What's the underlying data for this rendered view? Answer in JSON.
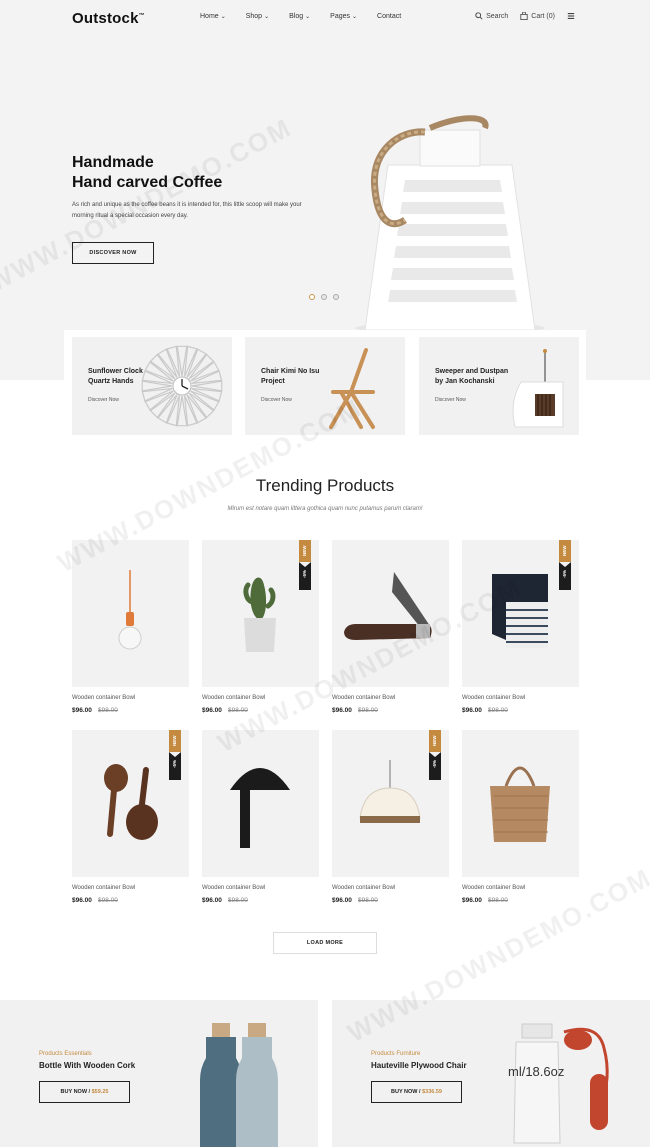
{
  "brand": {
    "name": "Outstock",
    "mark": "™"
  },
  "nav": [
    {
      "label": "Home",
      "dropdown": true
    },
    {
      "label": "Shop",
      "dropdown": true
    },
    {
      "label": "Blog",
      "dropdown": true
    },
    {
      "label": "Pages",
      "dropdown": true
    },
    {
      "label": "Contact",
      "dropdown": false
    }
  ],
  "tools": {
    "search": "Search",
    "cart": "Cart (0)"
  },
  "hero": {
    "title_line1": "Handmade",
    "title_line2": "Hand carved Coffee",
    "description": "As rich and unique as the coffee beans it is intended for, this little scoop will make your morning ritual a special occasion every day.",
    "button": "DISCOVER NOW",
    "slides": 3,
    "active_slide": 1
  },
  "categories": [
    {
      "title": "Sunflower Clock Quartz Hands",
      "link": "Discover Now"
    },
    {
      "title": "Chair Kimi No Isu Project",
      "link": "Discover Now"
    },
    {
      "title": "Sweeper and Dustpan by Jan Kochanski",
      "link": "Discover Now"
    }
  ],
  "trending": {
    "title": "Trending Products",
    "subtitle": "Mirum est notare quam littera gothica quam nunc putamus parum claram!",
    "products": [
      {
        "name": "Wooden container Bowl",
        "price": "$96.00",
        "old_price": "$98.00",
        "image": "pendant-bulb",
        "badge": false
      },
      {
        "name": "Wooden container Bowl",
        "price": "$96.00",
        "old_price": "$98.00",
        "image": "cactus-pot",
        "badge": true
      },
      {
        "name": "Wooden container Bowl",
        "price": "$96.00",
        "old_price": "$98.00",
        "image": "pocket-knife",
        "badge": false
      },
      {
        "name": "Wooden container Bowl",
        "price": "$96.00",
        "old_price": "$98.00",
        "image": "striped-towel",
        "badge": true
      },
      {
        "name": "Wooden container Bowl",
        "price": "$96.00",
        "old_price": "$98.00",
        "image": "wooden-spoons",
        "badge": true
      },
      {
        "name": "Wooden container Bowl",
        "price": "$96.00",
        "old_price": "$98.00",
        "image": "black-lamp",
        "badge": false
      },
      {
        "name": "Wooden container Bowl",
        "price": "$96.00",
        "old_price": "$98.00",
        "image": "pendant-lamp",
        "badge": true
      },
      {
        "name": "Wooden container Bowl",
        "price": "$96.00",
        "old_price": "$98.00",
        "image": "woven-bag",
        "badge": false
      }
    ],
    "badge_new": "NEW",
    "badge_sale": "-5%"
  },
  "load_more": "LOAD MORE",
  "promos": [
    {
      "sub": "Products Essentials",
      "title": "Bottle With Wooden Cork",
      "button": "BUY NOW",
      "price": "$59.25"
    },
    {
      "sub": "Products Furniture",
      "title": "Hauteville Plywood Chair",
      "button": "BUY NOW",
      "price": "$336.59"
    }
  ],
  "bottle_label": "ml/18.6oz",
  "watermark": "WWW.DOWNDEMO.COM",
  "colors": {
    "accent": "#c48a3f",
    "dark": "#1c1c1c",
    "hero_bg": "#f3f3f3"
  }
}
